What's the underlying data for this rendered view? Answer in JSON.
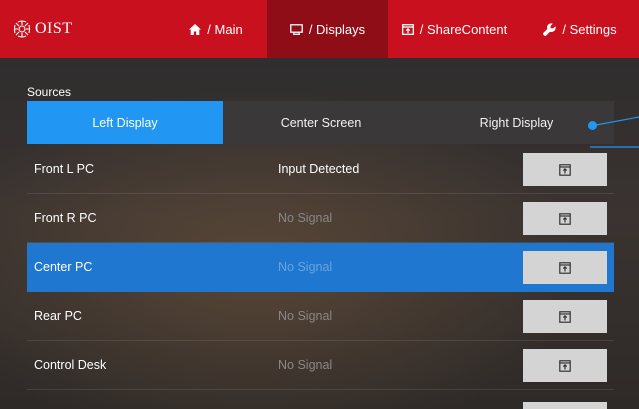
{
  "header": {
    "logo_text": "OIST",
    "nav": [
      {
        "label": "/ Main",
        "icon": "home-icon"
      },
      {
        "label": "/ Displays",
        "icon": "display-icon"
      },
      {
        "label": "/ ShareContent",
        "icon": "share-content-icon"
      },
      {
        "label": "/ Settings",
        "icon": "wrench-icon"
      }
    ]
  },
  "sources": {
    "label": "Sources",
    "tabs": [
      {
        "label": "Left Display",
        "selected": true
      },
      {
        "label": "Center Screen",
        "selected": false
      },
      {
        "label": "Right Display",
        "selected": false
      }
    ],
    "rows": [
      {
        "name": "Front L PC",
        "status": "Input Detected"
      },
      {
        "name": "Front R PC",
        "status": "No Signal"
      },
      {
        "name": "Center PC",
        "status": "No Signal",
        "selected": true
      },
      {
        "name": "Rear PC",
        "status": "No Signal"
      },
      {
        "name": "Control Desk",
        "status": "No Signal"
      }
    ]
  },
  "colors": {
    "header_red": "#c8101e",
    "header_active": "#8e0d16",
    "tab_selected": "#2196f3",
    "row_selected": "#1f77d0",
    "button_gray": "#d4d4d4"
  }
}
